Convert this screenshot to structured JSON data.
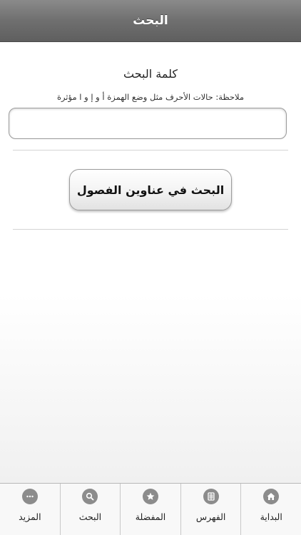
{
  "navbar": {
    "title": "البحث"
  },
  "search": {
    "label": "كلمة البحث",
    "note": "ملاحظة: حالات الأحرف مثل وضع الهمزة أ و إ و ا مؤثرة",
    "value": "",
    "placeholder": ""
  },
  "actions": {
    "search_titles_label": "البحث في عناوين الفصول"
  },
  "tabbar": {
    "tabs": [
      {
        "label": "البداية",
        "icon": "home-icon"
      },
      {
        "label": "الفهرس",
        "icon": "index-icon"
      },
      {
        "label": "المفضلة",
        "icon": "star-icon"
      },
      {
        "label": "البحث",
        "icon": "search-icon"
      },
      {
        "label": "المزيد",
        "icon": "more-icon"
      }
    ]
  },
  "colors": {
    "navbar": "#707070",
    "tab_icon": "#8c8c8c"
  }
}
